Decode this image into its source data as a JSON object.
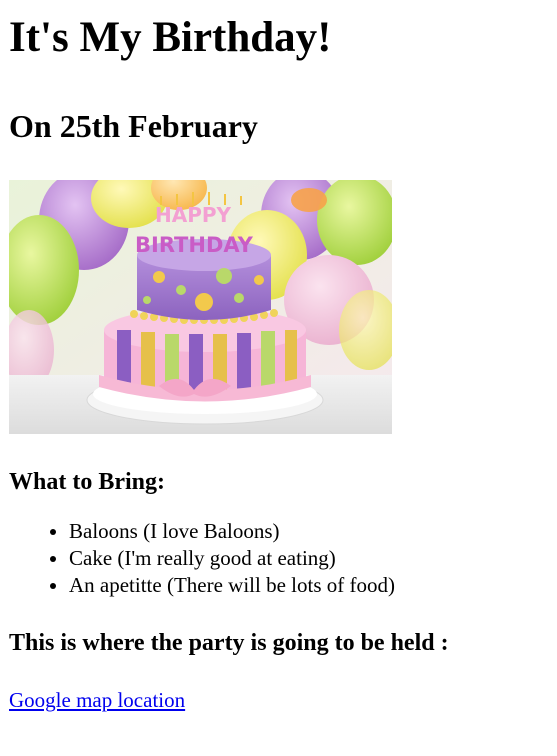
{
  "page": {
    "title": "It's My Birthday!",
    "date": "On 25th February",
    "cake_text": {
      "happy": "HAPPY",
      "birthday": "BIRTHDAY"
    },
    "bring": {
      "heading": "What to Bring:",
      "items": [
        "Baloons (I love Baloons)",
        "Cake (I'm really good at eating)",
        "An apetitte (There will be lots of food)"
      ]
    },
    "venue": {
      "heading": "This is where the party is going to be held :",
      "link_text": "Google map location"
    }
  },
  "colors": {
    "link": "#0000EE",
    "text": "#000000",
    "background": "#FFFFFF"
  }
}
